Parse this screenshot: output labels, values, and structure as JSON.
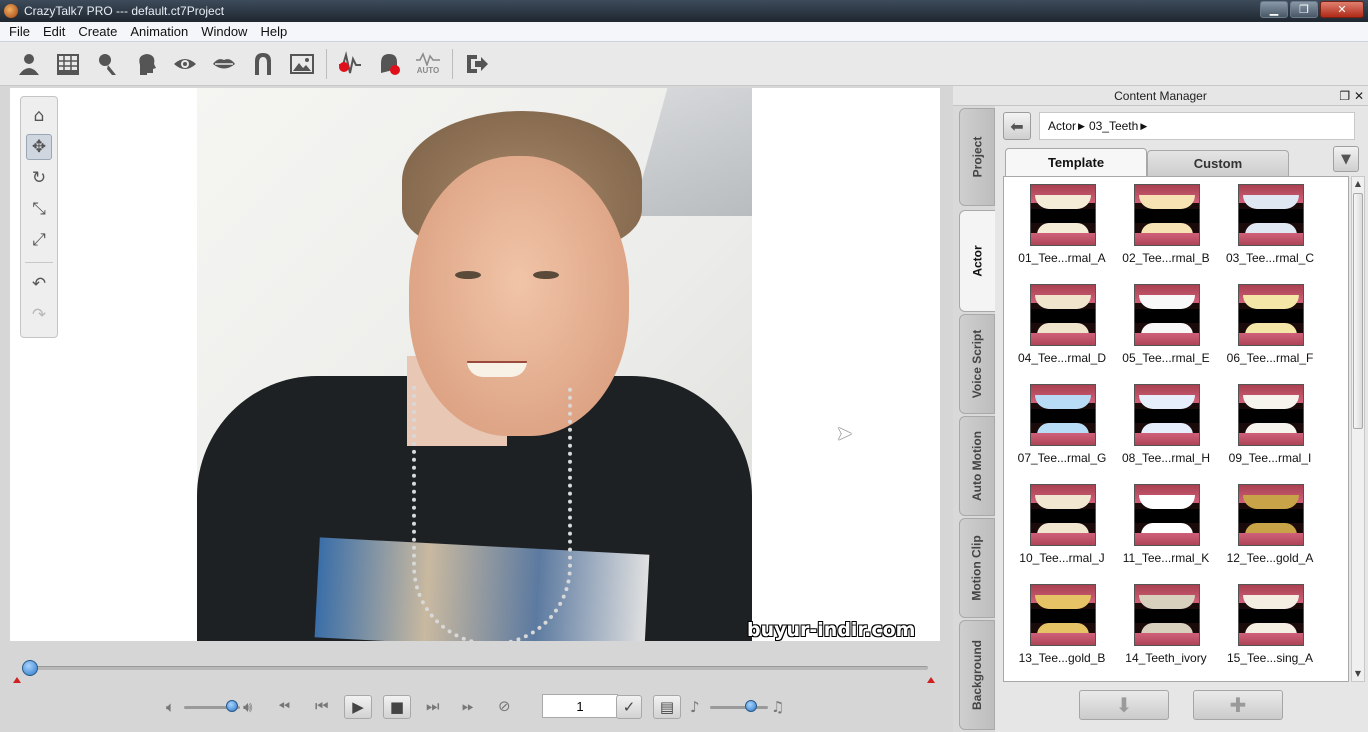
{
  "window": {
    "title": "CrazyTalk7 PRO --- default.ct7Project",
    "minimize": "▁",
    "maximize": "❐",
    "close": "✕"
  },
  "menu": [
    "File",
    "Edit",
    "Create",
    "Animation",
    "Window",
    "Help"
  ],
  "toolbar": {
    "icons": [
      "actor-icon",
      "face-fitting-icon",
      "face-orientation-icon",
      "face-profile-icon",
      "eye-icon",
      "mouth-icon",
      "head-mask-icon",
      "background-image-icon",
      "record-voice-icon",
      "record-puppet-icon",
      "auto-motion-icon",
      "export-icon"
    ],
    "auto_label": "AUTO"
  },
  "viewport": {
    "watermark": "buyur-indir.com"
  },
  "tools": [
    "home-icon",
    "move-icon",
    "rotate-icon",
    "scale-icon",
    "fit-icon",
    "undo-icon",
    "redo-icon"
  ],
  "playback": {
    "frame": "1",
    "timeline_position": 0.0,
    "volume_level": 0.85,
    "speed_level": 0.7
  },
  "content_manager": {
    "title": "Content Manager",
    "vertical_tabs": [
      "Project",
      "Actor",
      "Voice Script",
      "Auto Motion",
      "Motion Clip",
      "Background"
    ],
    "active_vtab": "Actor",
    "breadcrumb": [
      "Actor",
      "03_Teeth"
    ],
    "tabs": {
      "template": "Template",
      "custom": "Custom"
    },
    "items": [
      {
        "label": "01_Tee...rmal_A",
        "tint": "#f4ecd6"
      },
      {
        "label": "02_Tee...rmal_B",
        "tint": "#f6e2b2"
      },
      {
        "label": "03_Tee...rmal_C",
        "tint": "#dfe7f2"
      },
      {
        "label": "04_Tee...rmal_D",
        "tint": "#f0e4cc"
      },
      {
        "label": "05_Tee...rmal_E",
        "tint": "#f8f8f8"
      },
      {
        "label": "06_Tee...rmal_F",
        "tint": "#f4e6a6"
      },
      {
        "label": "07_Tee...rmal_G",
        "tint": "#b8dcf6"
      },
      {
        "label": "08_Tee...rmal_H",
        "tint": "#e6eefb"
      },
      {
        "label": "09_Tee...rmal_I",
        "tint": "#f6f3ec"
      },
      {
        "label": "10_Tee...rmal_J",
        "tint": "#f1e6cf"
      },
      {
        "label": "11_Tee...rmal_K",
        "tint": "#ffffff"
      },
      {
        "label": "12_Tee...gold_A",
        "tint": "#c9a347"
      },
      {
        "label": "13_Tee...gold_B",
        "tint": "#e6c465"
      },
      {
        "label": "14_Teeth_ivory",
        "tint": "#d8d0bc"
      },
      {
        "label": "15_Tee...sing_A",
        "tint": "#f3ede2"
      }
    ]
  }
}
